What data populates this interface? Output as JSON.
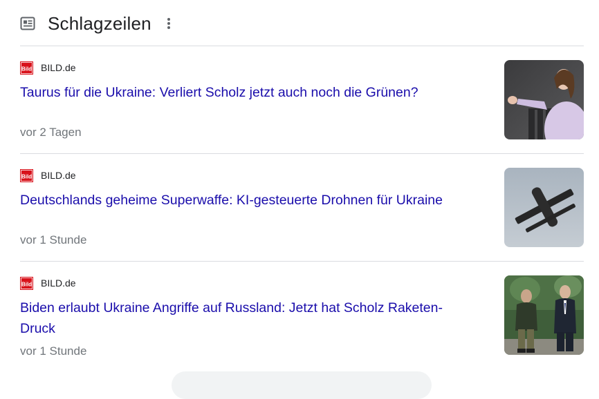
{
  "section": {
    "title": "Schlagzeilen",
    "header_icon": "news-icon",
    "more_icon": "more-vert-icon"
  },
  "articles": [
    {
      "source": "BILD.de",
      "logo_text": "Bild",
      "headline": "Taurus für die Ukraine: Verliert Scholz jetzt auch noch die Grünen?",
      "time": "vor 2 Tagen",
      "thumbnail": "woman-speaking-at-podium-photo"
    },
    {
      "source": "BILD.de",
      "logo_text": "Bild",
      "headline": "Deutschlands geheime Superwaffe: KI-gesteuerte Drohnen für Ukraine",
      "time": "vor 1 Stunde",
      "thumbnail": "drone-in-sky-photo"
    },
    {
      "source": "BILD.de",
      "logo_text": "Bild",
      "headline": "Biden erlaubt Ukraine Angriffe auf Russland: Jetzt hat Scholz Raketen-Druck",
      "time": "vor 1 Stunde",
      "thumbnail": "two-men-walking-photo"
    }
  ],
  "colors": {
    "link": "#1a0dab",
    "muted": "#70757a",
    "bild_red": "#d8111a",
    "divider": "#dadce0"
  }
}
